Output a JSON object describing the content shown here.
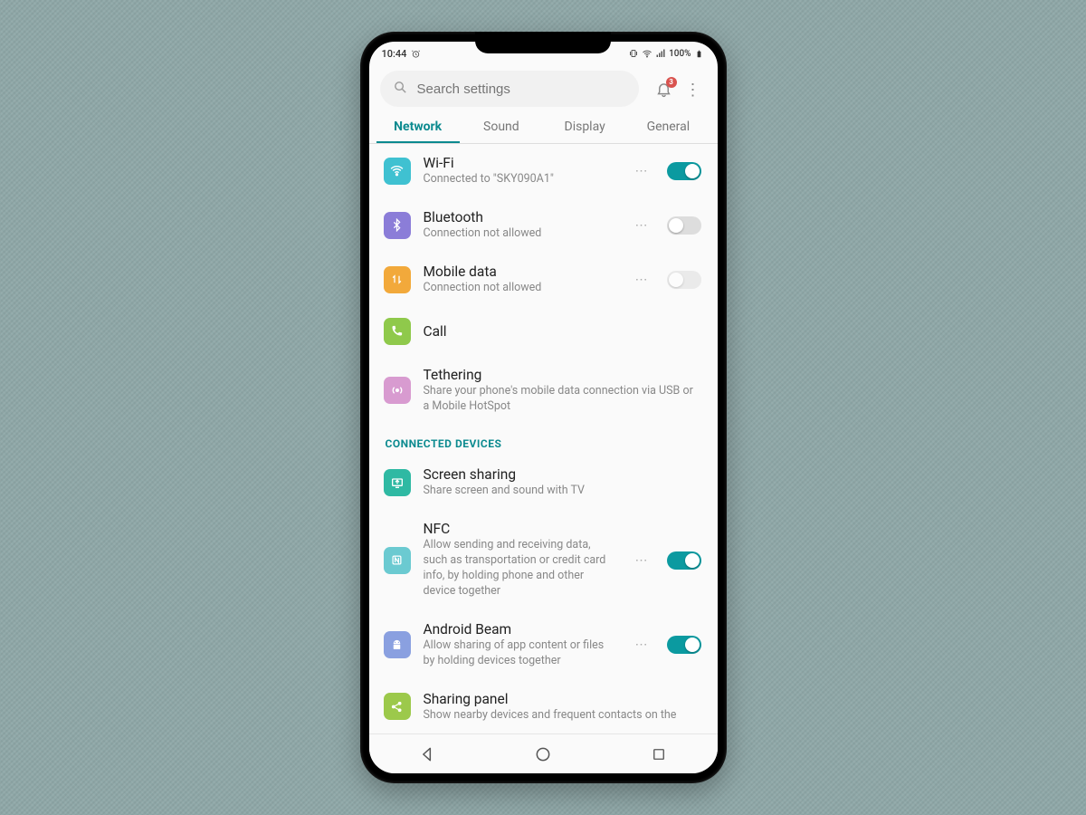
{
  "status": {
    "time": "10:44",
    "alarm_icon": "alarm-icon",
    "vibrate_icon": "vibrate-icon",
    "wifi_icon": "wifi-icon",
    "signal_icon": "signal-icon",
    "battery_pct": "100%",
    "battery_icon": "battery-full-icon"
  },
  "search": {
    "placeholder": "Search settings"
  },
  "header": {
    "notif_count": "3"
  },
  "tabs": [
    {
      "label": "Network",
      "active": true
    },
    {
      "label": "Sound",
      "active": false
    },
    {
      "label": "Display",
      "active": false
    },
    {
      "label": "General",
      "active": false
    }
  ],
  "section_header": "CONNECTED DEVICES",
  "items": {
    "wifi": {
      "title": "Wi-Fi",
      "sub": "Connected to \"SKY090A1\"",
      "toggle": true,
      "icon_bg": "#3fc1d1"
    },
    "bt": {
      "title": "Bluetooth",
      "sub": "Connection not allowed",
      "toggle": false,
      "icon_bg": "#8b7dd8"
    },
    "data": {
      "title": "Mobile data",
      "sub": "Connection not allowed",
      "toggle": false,
      "icon_bg": "#f2a93b"
    },
    "call": {
      "title": "Call",
      "icon_bg": "#8fc94b"
    },
    "tether": {
      "title": "Tethering",
      "sub": "Share your phone's mobile data connection via USB or a Mobile HotSpot",
      "icon_bg": "#d89bd0"
    },
    "screen": {
      "title": "Screen sharing",
      "sub": "Share screen and sound with TV",
      "icon_bg": "#2fb9a3"
    },
    "nfc": {
      "title": "NFC",
      "sub": "Allow sending and receiving data, such as transportation or credit card info, by holding phone and other device together",
      "toggle": true,
      "icon_bg": "#6bcad1"
    },
    "beam": {
      "title": "Android Beam",
      "sub": "Allow sharing of app content or files by holding devices together",
      "toggle": true,
      "icon_bg": "#8aa0e0"
    },
    "panel": {
      "title": "Sharing panel",
      "sub": "Show nearby devices and frequent contacts on the",
      "icon_bg": "#9cc94b"
    }
  },
  "ellipsis": "⋯"
}
